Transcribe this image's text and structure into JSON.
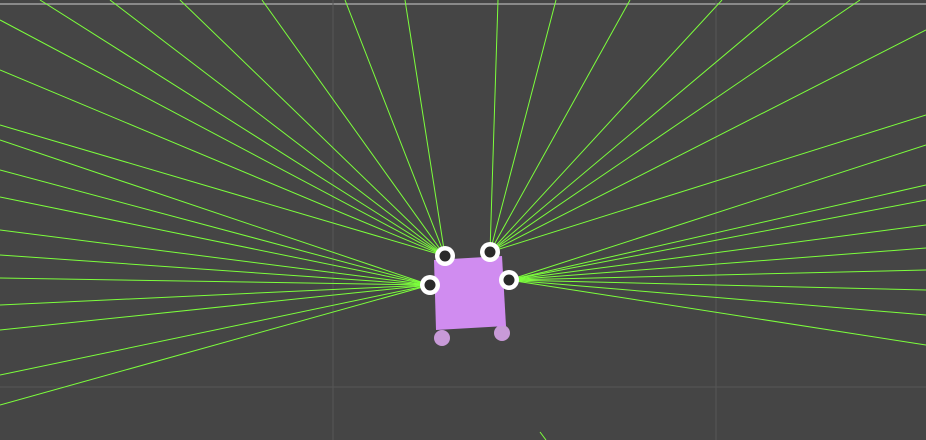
{
  "scene": {
    "kind": "2d-editor-viewport",
    "colors": {
      "background": "#454545",
      "grid": "#565656",
      "top_border": "#a0a0a0",
      "ray": "#7cff3c",
      "robot_body": "#d08cf0",
      "robot_wheel": "#c89ad8",
      "sensor_ring": "#ffffff",
      "sensor_core": "#2a2a2a"
    },
    "robot": {
      "name": "robot-body",
      "sensors": [
        {
          "name": "sensor-front-left"
        },
        {
          "name": "sensor-front-right"
        },
        {
          "name": "sensor-left"
        },
        {
          "name": "sensor-right"
        }
      ],
      "wheels": [
        {
          "name": "wheel-rear-left"
        },
        {
          "name": "wheel-rear-right"
        }
      ]
    },
    "ray_count": 36
  }
}
